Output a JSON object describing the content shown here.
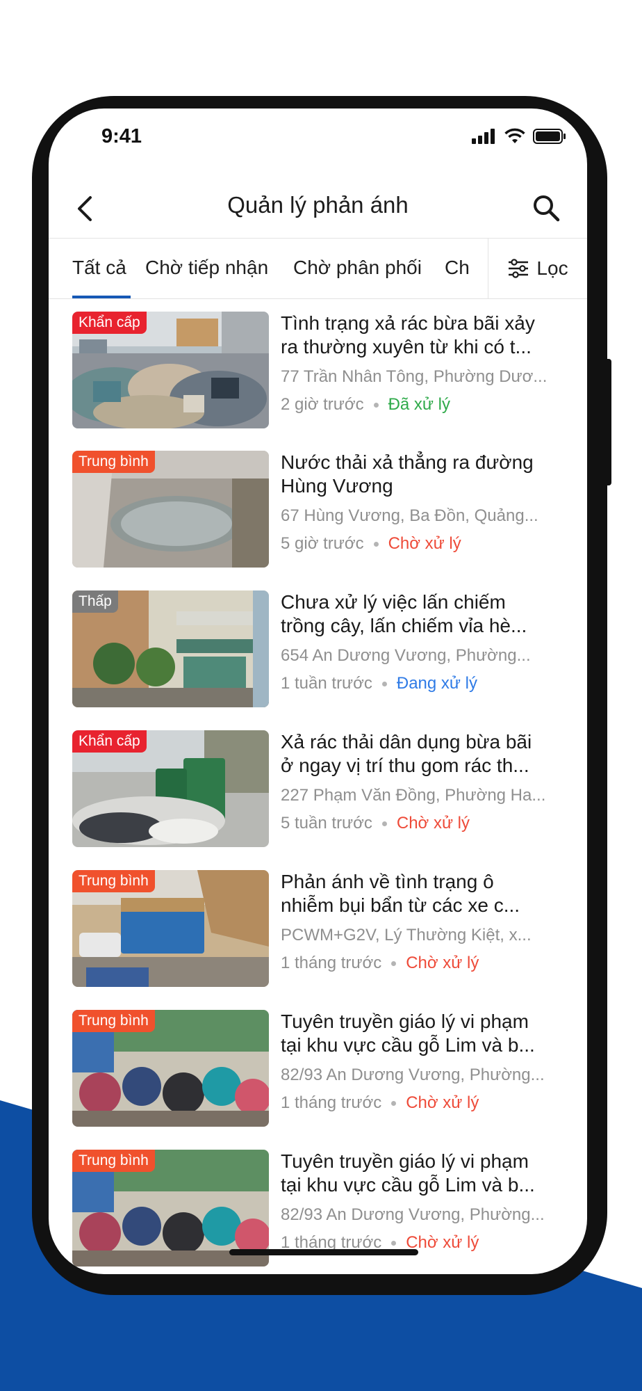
{
  "status_bar": {
    "time": "9:41"
  },
  "header": {
    "title": "Quản lý phản ánh"
  },
  "tabs": [
    {
      "label": "Tất cả",
      "active": true
    },
    {
      "label": "Chờ tiếp nhận",
      "active": false
    },
    {
      "label": "Chờ phân phối",
      "active": false
    },
    {
      "label": "Ch",
      "active": false
    }
  ],
  "filter": {
    "label": "Lọc",
    "icon": "sliders-icon"
  },
  "colors": {
    "accent": "#1658b5",
    "brand_blue": "#0d4ea3",
    "done": "#2faa4a",
    "waiting": "#ee4b39",
    "processing": "#2f7be6"
  },
  "reports": [
    {
      "priority": "Khẩn cấp",
      "title_line1": "Tình trạng xả rác bừa bãi xảy",
      "title_line2": "ra thường xuyên từ khi có t...",
      "address": "77 Trần Nhân Tông, Phường Dươ...",
      "time": "2 giờ trước",
      "status": "Đã xử lý"
    },
    {
      "priority": "Trung bình",
      "title_line1": "Nước thải xả thẳng ra đường",
      "title_line2": "Hùng Vương",
      "address": "67 Hùng Vương, Ba Đồn, Quảng...",
      "time": "5 giờ trước",
      "status": "Chờ xử lý"
    },
    {
      "priority": "Thấp",
      "title_line1": "Chưa xử lý việc lấn chiếm",
      "title_line2": "trồng cây, lấn chiếm vỉa hè...",
      "address": "654 An Dương Vương, Phường...",
      "time": "1 tuần trước",
      "status": "Đang xử lý"
    },
    {
      "priority": "Khẩn cấp",
      "title_line1": "Xả rác thải dân dụng bừa bãi",
      "title_line2": "ở ngay vị trí thu gom rác th...",
      "address": "227 Phạm Văn Đồng, Phường Ha...",
      "time": "5 tuần trước",
      "status": "Chờ xử lý"
    },
    {
      "priority": "Trung bình",
      "title_line1": "Phản ánh về tình trạng ô",
      "title_line2": "nhiễm bụi bẩn từ các xe c...",
      "address": "PCWM+G2V, Lý Thường Kiệt, x...",
      "time": "1 tháng trước",
      "status": "Chờ xử lý"
    },
    {
      "priority": "Trung bình",
      "title_line1": "Tuyên truyền giáo lý vi phạm",
      "title_line2": "tại khu vực cầu gỗ Lim và b...",
      "address": "82/93 An Dương Vương, Phường...",
      "time": "1 tháng trước",
      "status": "Chờ xử lý"
    },
    {
      "priority": "Trung bình",
      "title_line1": "Tuyên truyền giáo lý vi phạm",
      "title_line2": "tại khu vực cầu gỗ Lim và b...",
      "address": "82/93 An Dương Vương, Phường...",
      "time": "1 tháng trước",
      "status": "Chờ xử lý"
    }
  ]
}
